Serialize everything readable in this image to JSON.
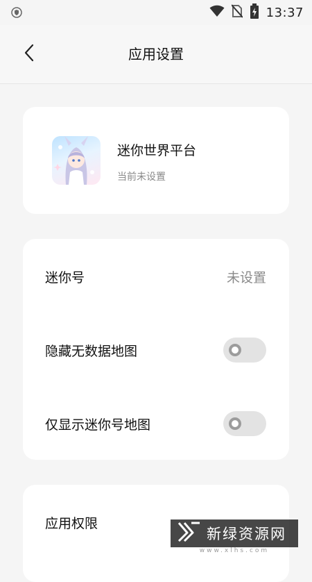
{
  "status_bar": {
    "time": "13:37",
    "icons": [
      "shield-icon",
      "wifi-icon",
      "no-sim-icon",
      "battery-charging-icon"
    ]
  },
  "header": {
    "title": "应用设置",
    "back_icon": "chevron-left-icon"
  },
  "app_card": {
    "name": "迷你世界平台",
    "status": "当前未设置",
    "icon": "anime-character-app-icon"
  },
  "settings": {
    "rows": [
      {
        "label": "迷你号",
        "value": "未设置"
      },
      {
        "label": "隐藏无数据地图",
        "toggle": "off"
      },
      {
        "label": "仅显示迷你号地图",
        "toggle": "off"
      }
    ]
  },
  "permissions": {
    "label": "应用权限"
  },
  "watermark": {
    "text": "新绿资源网",
    "sub": "www.xlhs.com"
  },
  "colors": {
    "background": "#f5f5f5",
    "card": "#ffffff",
    "secondary_text": "#8a8a8a",
    "toggle_track": "#e3e3e3"
  }
}
